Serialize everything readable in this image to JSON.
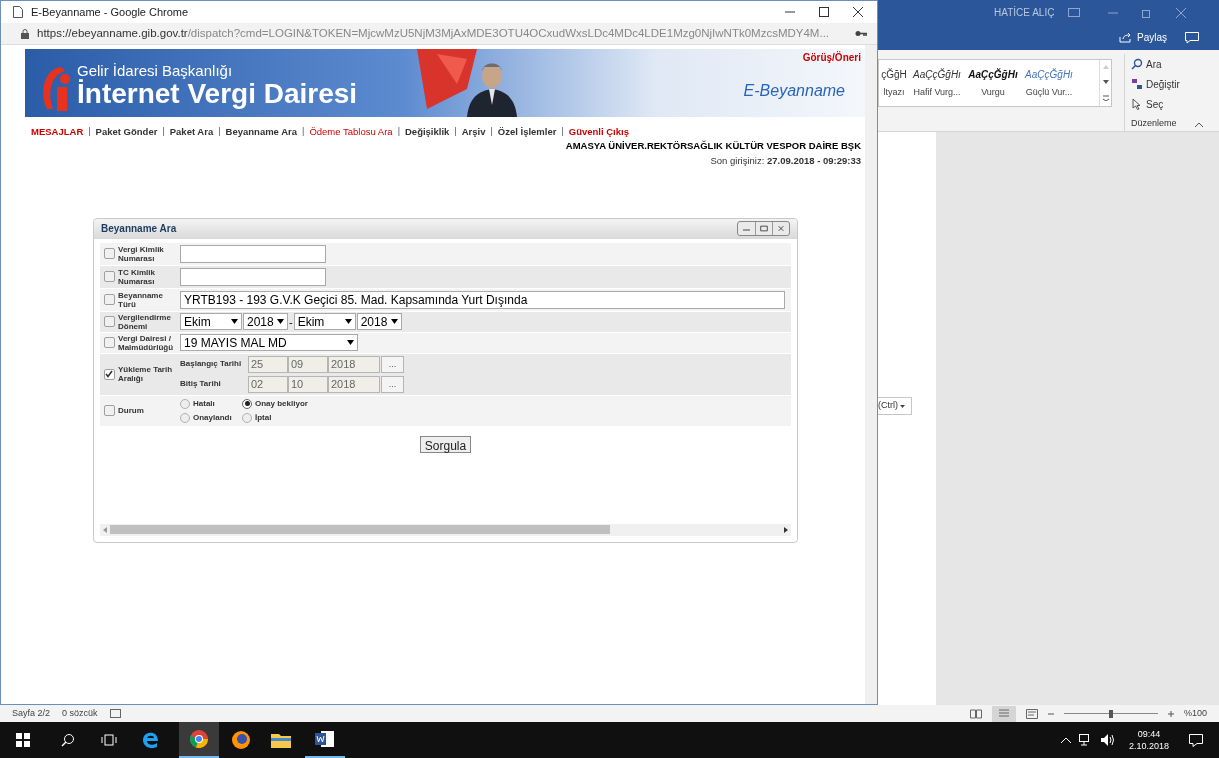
{
  "word": {
    "user": "HATİCE ALIÇ",
    "share": "Paylaş",
    "styles": [
      {
        "sample": "çĞğH",
        "name": "ltyazı",
        "kind": "plain"
      },
      {
        "sample": "AaÇçĞğHı",
        "name": "Hafif Vurg...",
        "kind": "subtle"
      },
      {
        "sample": "AaÇçĞğHı",
        "name": "Vurgu",
        "kind": "emphasis"
      },
      {
        "sample": "AaÇçĞğHı",
        "name": "Güçlü Vur...",
        "kind": "intense"
      }
    ],
    "editing": [
      "Ara",
      "Değiştir",
      "Seç"
    ],
    "editing_group": "Düzenleme",
    "paste_options": "(Ctrl)",
    "status": {
      "page": "Sayfa 2/2",
      "words": "0 sözcük",
      "zoom": "%100",
      "zoom_slider": {
        "level": 0.5
      }
    }
  },
  "taskbar": {
    "time": "09:44",
    "date": "2.10.2018"
  },
  "browser": {
    "title": "E-Beyanname - Google Chrome",
    "url_host": "https://ebeyanname.gib.gov.tr",
    "url_path": "/dispatch?cmd=LOGIN&TOKEN=MjcwMzU5NjM3MjAxMDE3OTU4OCxudWxsLDc4MDc4LDE1Mzg0NjIwNTk0MzcsMDY4M...",
    "header": {
      "org": "Gelir İdaresi Başkanlığı",
      "title": "İnternet Vergi Dairesi",
      "product": "E-Beyanname",
      "feedback": "Görüş/Öneri"
    },
    "nav_separator": "|",
    "nav": [
      {
        "label": "MESAJLAR",
        "kind": "red-bold"
      },
      {
        "label": "Paket Gönder",
        "kind": "bold"
      },
      {
        "label": "Paket Ara",
        "kind": "bold"
      },
      {
        "label": "Beyanname Ara",
        "kind": "bold"
      },
      {
        "label": "Ödeme Tablosu Ara",
        "kind": "red"
      },
      {
        "label": "Değişiklik",
        "kind": "bold"
      },
      {
        "label": "Arşiv",
        "kind": "bold"
      },
      {
        "label": "Özel İşlemler",
        "kind": "bold"
      },
      {
        "label": "Güvenli Çıkış",
        "kind": "red-bold"
      }
    ],
    "user": {
      "org": "AMASYA ÜNİVER.REKTÖRSAĞLIK KÜLTÜR VESPOR DAİRE BŞK",
      "last_login_label": "Son girişiniz:",
      "last_login": "27.09.2018 - 09:29:33"
    },
    "panel": {
      "title": "Beyanname Ara",
      "submit": "Sorgula",
      "rows": [
        {
          "kind": "text",
          "label": "Vergi Kimlik Numarası",
          "checked": false
        },
        {
          "kind": "text",
          "label": "TC Kimlik Numarası",
          "checked": false
        },
        {
          "kind": "wide",
          "label": "Beyanname Türü",
          "checked": false,
          "value": "YRTB193 - 193 G.V.K Geçici 85. Mad. Kapsamında Yurt Dışında"
        },
        {
          "kind": "period",
          "label": "Vergilendirme Dönemi",
          "checked": false,
          "selects": [
            "Ekim",
            "2018",
            "Ekim",
            "2018"
          ],
          "separator": "-"
        },
        {
          "kind": "select",
          "label": "Vergi Dairesi / Malmüdürlüğü",
          "checked": false,
          "value": "19 MAYIS MAL MD"
        },
        {
          "kind": "dates",
          "label": "Yükleme Tarih Aralığı",
          "checked": true,
          "ranges": [
            {
              "label": "Başlangıç Tarihi",
              "parts": [
                "25",
                "09",
                "2018"
              ],
              "button": "..."
            },
            {
              "label": "Bitiş Tarihi",
              "parts": [
                "02",
                "10",
                "2018"
              ],
              "button": "..."
            }
          ]
        },
        {
          "kind": "radios",
          "label": "Durum",
          "checked": false,
          "options": [
            {
              "label": "Hatalı",
              "selected": false
            },
            {
              "label": "Onay bekliyor",
              "selected": true
            },
            {
              "label": "Onaylandı",
              "selected": false
            },
            {
              "label": "İptal",
              "selected": false
            }
          ]
        }
      ]
    }
  }
}
